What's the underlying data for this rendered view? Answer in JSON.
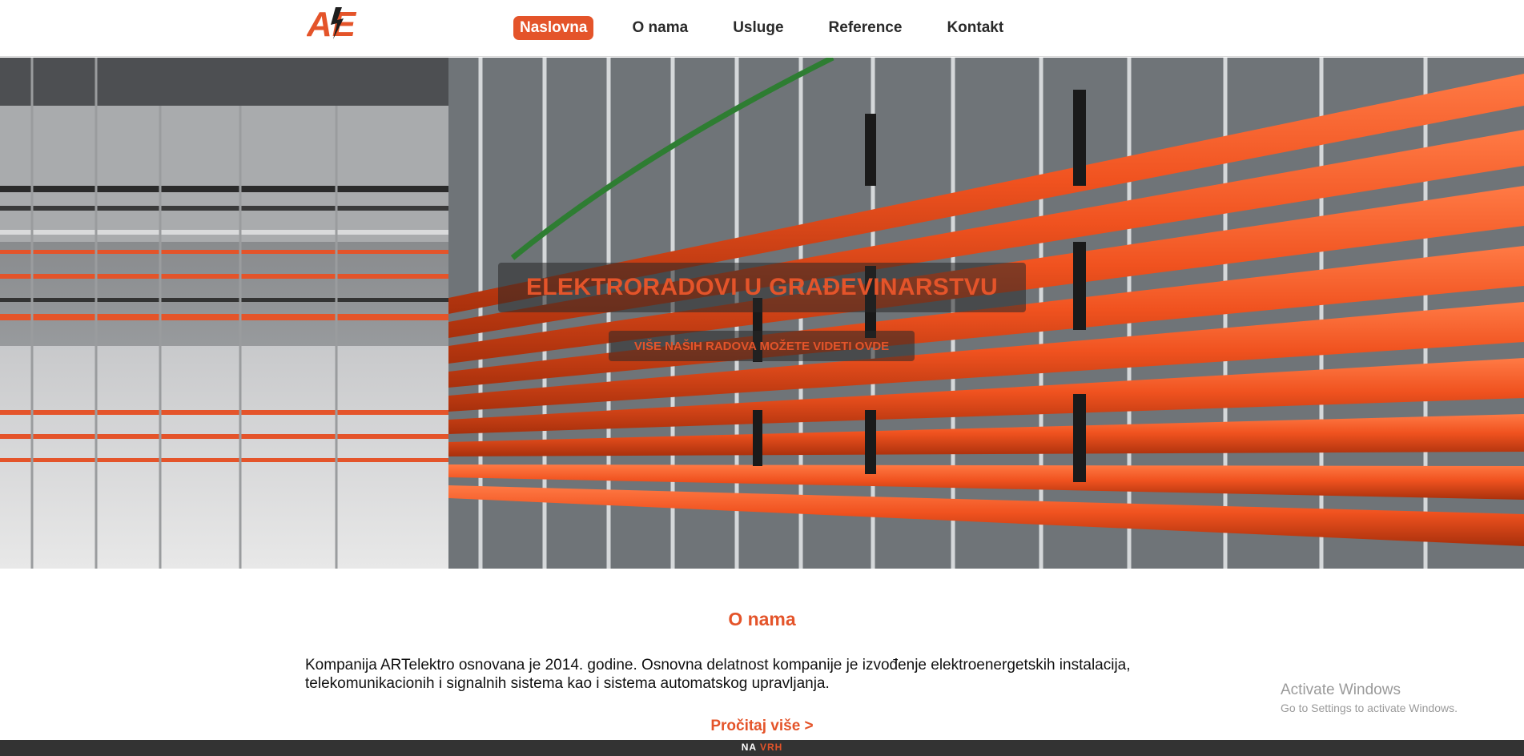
{
  "header": {
    "logo_text": "AE",
    "nav": [
      {
        "label": "Naslovna",
        "active": true
      },
      {
        "label": "O nama",
        "active": false
      },
      {
        "label": "Usluge",
        "active": false
      },
      {
        "label": "Reference",
        "active": false
      },
      {
        "label": "Kontakt",
        "active": false
      }
    ]
  },
  "hero": {
    "title": "ELEKTRORADOVI U GRAĐEVINARSTVU",
    "button_label": "VIŠE NAŠIH RADOVA MOŽETE VIDETI OVDE"
  },
  "about": {
    "heading": "O nama",
    "text": "Kompanija ARTelektro osnovana je 2014. godine. Osnovna delatnost kompanije je izvođenje elektroenergetskih instalacija, telekomunikacionih i signalnih sistema kao i sistema automatskog upravljanja.",
    "read_more": "Pročitaj više >"
  },
  "watermark": {
    "title": "Activate Windows",
    "subtitle": "Go to Settings to activate Windows."
  },
  "footer": {
    "to_top_word1": "NA",
    "to_top_word2": "VRH"
  },
  "colors": {
    "accent": "#e4542a",
    "footer_bg": "#333333",
    "text": "#111111"
  }
}
